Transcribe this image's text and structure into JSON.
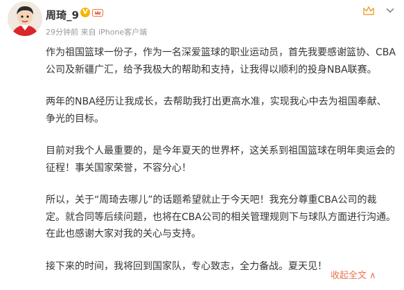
{
  "post": {
    "author": "周琦_9",
    "time": "29分钟前",
    "source_prefix": "来自",
    "source": "iPhone客户端",
    "paragraphs": [
      "作为祖国篮球一份子，作为一名深爱篮球的职业运动员，首先我要感谢篮协、CBA公司及新疆广汇，给予我极大的帮助和支持，让我得以顺利的投身NBA联赛。",
      "两年的NBA经历让我成长，去帮助我打出更高水准，实现我心中去为祖国奉献、争光的目标。",
      "目前对我个人最重要的，是今年夏天的世界杯，这关系到祖国篮球在明年奥运会的征程！事关国家荣誉，不容分心！",
      "所以，关于“周琦去哪儿”的话题希望就止于今天吧！我充分尊重CBA公司的裁定。就合同等后续问题，也将在CBA公司的相关管理规则下与球队方面进行沟通。在此也感谢大家对我的关心与支持。",
      "接下来的时间，我将回到国家队，专心致志，全力备战。夏天见！"
    ],
    "collapse_label": "收起全文 ∧"
  },
  "icons": {
    "verified": "verified-v-icon",
    "vip": "vip-crown-icon",
    "top_right_a": "crown-icon",
    "top_right_b": "chevron-down-icon"
  },
  "colors": {
    "link": "#eb7350",
    "verified": "#f7b500",
    "meta": "#999999"
  }
}
